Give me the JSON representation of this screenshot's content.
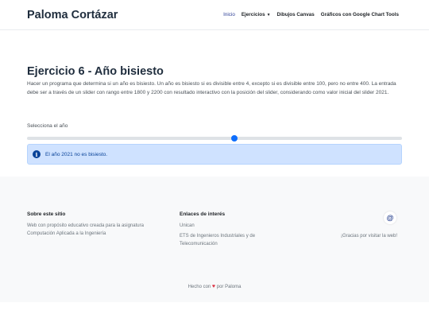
{
  "header": {
    "brand": "Paloma Cortázar",
    "nav": [
      {
        "label": "Inicio",
        "active": true
      },
      {
        "label": "Ejercicios",
        "dropdown": true
      },
      {
        "label": "Dibujos Canvas"
      },
      {
        "label": "Gráficos con Google Chart Tools"
      }
    ]
  },
  "main": {
    "title": "Ejercicio 6 - Año bisiesto",
    "description": "Hacer un programa que determina si un año es bisiesto. Un año es bisiesto si es divisible entre 4, excepto si es divisible entre 100, pero no entre 400. La entrada debe ser a través de un slider con rango entre 1800 y 2200 con resultado interactivo con la posición del slider, considerando como valor inicial del slider 2021.",
    "slider": {
      "label": "Selecciona el año",
      "min": 1800,
      "max": 2200,
      "value": 2021
    },
    "alert": {
      "text": "El año 2021 no es bisiesto.",
      "icon": "info-icon"
    }
  },
  "footer": {
    "about": {
      "title": "Sobre este sitio",
      "text": "Web con propósito educativo creada para la asignatura Computación Aplicada a la Ingeniería"
    },
    "links": {
      "title": "Enlaces de interés",
      "items": [
        "Unican",
        "ETS de Ingenieros Industriales y de Telecomunicación"
      ]
    },
    "contact_icon": "at-icon",
    "thanks": "¡Gracias por visitar la web!",
    "made_prefix": "Hecho con",
    "made_suffix": "por Paloma"
  },
  "colors": {
    "accent": "#0d6efd",
    "alert_bg": "#cfe2ff",
    "alert_text": "#084298",
    "heart": "#dc3545"
  }
}
